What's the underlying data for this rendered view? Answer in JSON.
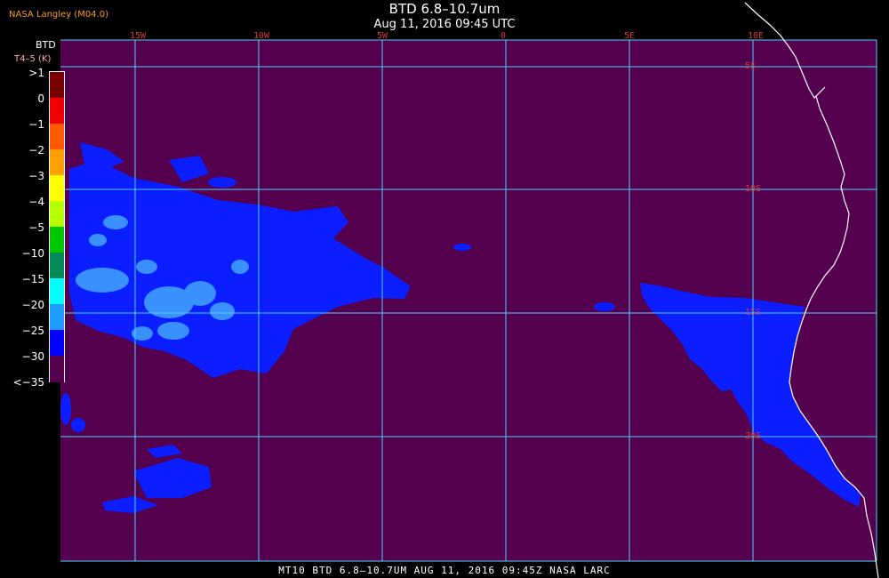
{
  "header": {
    "source": "NASA Langley (M04.0)",
    "title": "BTD 6.8–10.7um",
    "datetime": "Aug 11, 2016 09:45 UTC"
  },
  "legend": {
    "title": "BTD",
    "units": "T4–5 (K)",
    "labels": [
      ">1",
      "0",
      "−1",
      "−2",
      "−3",
      "−4",
      "−5",
      "−10",
      "−15",
      "−20",
      "−25",
      "−30",
      "<−35"
    ],
    "colors": [
      "#7a0000",
      "#ee0000",
      "#ff5a00",
      "#ff9f00",
      "#ffff00",
      "#b5ff00",
      "#00c800",
      "#008a5a",
      "#00ffff",
      "#1e9cff",
      "#0000ff",
      "#55004f"
    ]
  },
  "map": {
    "background_color": "#55004f",
    "grid_color": "#4fd0ff",
    "cloud_color": "#0a1eff",
    "cloud_light_color": "#3a90ff",
    "coast_color": "#ffffff",
    "lon_labels": [
      "15W",
      "10W",
      "5W",
      "0",
      "5E",
      "10E"
    ],
    "lat_labels": [
      "5S",
      "10S",
      "15S",
      "20S"
    ]
  },
  "footer": {
    "text": "MT10  BTD 6.8–10.7UM   AUG 11, 2016 09:45Z   NASA LARC"
  }
}
